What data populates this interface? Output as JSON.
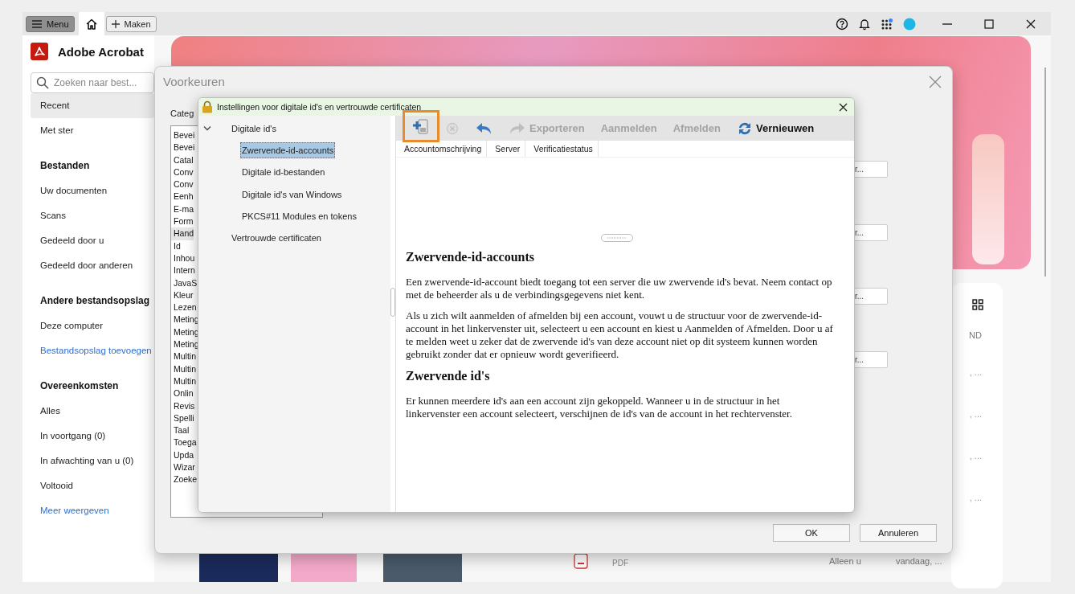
{
  "topbar": {
    "menu_label": "Menu",
    "new_label": "Maken"
  },
  "app": {
    "title": "Adobe Acrobat",
    "search_placeholder": "Zoeken naar best..."
  },
  "sidebar": {
    "sections": [
      {
        "items": [
          {
            "label": "Recent",
            "kind": "item",
            "selected": true
          },
          {
            "label": "Met ster",
            "kind": "item",
            "selected": false
          }
        ]
      },
      {
        "heading": "Bestanden",
        "items": [
          {
            "label": "Uw documenten",
            "kind": "item",
            "selected": false
          },
          {
            "label": "Scans",
            "kind": "item",
            "selected": false
          },
          {
            "label": "Gedeeld door u",
            "kind": "item",
            "selected": false
          },
          {
            "label": "Gedeeld door anderen",
            "kind": "item",
            "selected": false
          }
        ]
      },
      {
        "heading": "Andere bestandsopslag",
        "items": [
          {
            "label": "Deze computer",
            "kind": "item",
            "selected": false
          },
          {
            "label": "Bestandsopslag toevoegen",
            "kind": "link",
            "selected": false
          }
        ]
      },
      {
        "heading": "Overeenkomsten",
        "items": [
          {
            "label": "Alles",
            "kind": "item",
            "selected": false
          },
          {
            "label": "In voortgang (0)",
            "kind": "item",
            "selected": false
          },
          {
            "label": "In afwachting van u (0)",
            "kind": "item",
            "selected": false
          },
          {
            "label": "Voltooid",
            "kind": "item",
            "selected": false
          },
          {
            "label": "Meer weergeven",
            "kind": "link",
            "selected": false
          }
        ]
      }
    ]
  },
  "background": {
    "row_buttons": [
      "r...",
      "r...",
      "r...",
      "r..."
    ],
    "column_label": "ND",
    "row_dates": [
      ", ...",
      ", ...",
      ", ...",
      ", ..."
    ],
    "file_type": "PDF",
    "owner": "Alleen u",
    "date": "vandaag, ..."
  },
  "preferences": {
    "title": "Voorkeuren",
    "categories_label": "Categ",
    "categories": [
      {
        "label": "Bevei",
        "selected": false
      },
      {
        "label": "Bevei",
        "selected": false
      },
      {
        "label": "Catal",
        "selected": false
      },
      {
        "label": "Conv",
        "selected": false
      },
      {
        "label": "Conv",
        "selected": false
      },
      {
        "label": "Eenh",
        "selected": false
      },
      {
        "label": "E-ma",
        "selected": false
      },
      {
        "label": "Form",
        "selected": false
      },
      {
        "label": "Hand",
        "selected": true
      },
      {
        "label": "Id",
        "selected": false
      },
      {
        "label": "Inhou",
        "selected": false
      },
      {
        "label": "Intern",
        "selected": false
      },
      {
        "label": "JavaS",
        "selected": false
      },
      {
        "label": "Kleur",
        "selected": false
      },
      {
        "label": "Lezen",
        "selected": false
      },
      {
        "label": "Meting",
        "selected": false
      },
      {
        "label": "Meting",
        "selected": false
      },
      {
        "label": "Meting",
        "selected": false
      },
      {
        "label": "Multin",
        "selected": false
      },
      {
        "label": "Multin",
        "selected": false
      },
      {
        "label": "Multin",
        "selected": false
      },
      {
        "label": "Onlin",
        "selected": false
      },
      {
        "label": "Revis",
        "selected": false
      },
      {
        "label": "Spelli",
        "selected": false
      },
      {
        "label": "Taal",
        "selected": false
      },
      {
        "label": "Toega",
        "selected": false
      },
      {
        "label": "Upda",
        "selected": false
      },
      {
        "label": "Wizar",
        "selected": false
      },
      {
        "label": "Zoeke",
        "selected": false
      }
    ],
    "buttons": [
      "OK",
      "Annuleren"
    ]
  },
  "id_dialog": {
    "title": "Instellingen voor digitale id's en vertrouwde certificaten",
    "tree": [
      {
        "label": "Digitale id's",
        "selected": false,
        "expanded": true,
        "children": [
          {
            "label": "Zwervende-id-accounts",
            "selected": true
          },
          {
            "label": "Digitale id-bestanden",
            "selected": false
          },
          {
            "label": "Digitale id's van Windows",
            "selected": false
          },
          {
            "label": "PKCS#11 Modules en tokens",
            "selected": false
          }
        ]
      },
      {
        "label": "Vertrouwde certificaten",
        "selected": false
      }
    ],
    "toolbar": [
      {
        "kind": "add",
        "disabled": false,
        "highlighted": true
      },
      {
        "kind": "remove",
        "disabled": true,
        "highlighted": false
      },
      {
        "kind": "back",
        "disabled": false,
        "highlighted": false
      },
      {
        "kind": "export",
        "label": "Exporteren",
        "disabled": true,
        "highlighted": false
      },
      {
        "kind": "text",
        "label": "Aanmelden",
        "disabled": true,
        "highlighted": false
      },
      {
        "kind": "text",
        "label": "Afmelden",
        "disabled": true,
        "highlighted": false
      },
      {
        "kind": "refresh",
        "label": "Vernieuwen",
        "disabled": false,
        "highlighted": false
      }
    ],
    "columns": [
      "Accountomschrijving",
      "Server",
      "Verificatiestatus"
    ],
    "help": [
      {
        "kind": "heading",
        "text": "Zwervende-id-accounts"
      },
      {
        "kind": "paragraph",
        "text": "Een zwervende-id-account biedt toegang tot een server die uw zwervende id's bevat. Neem contact op met de beheerder als u de verbindingsgegevens niet kent."
      },
      {
        "kind": "paragraph",
        "text": "Als u zich wilt aanmelden of afmelden bij een account, vouwt u de structuur voor de zwervende-id-account in het linkervenster uit, selecteert u een account en kiest u Aanmelden of Afmelden. Door u af te melden weet u zeker dat de zwervende id's van deze account niet op dit systeem kunnen worden gebruikt zonder dat er opnieuw wordt geverifieerd."
      },
      {
        "kind": "heading",
        "text": "Zwervende id's"
      },
      {
        "kind": "paragraph",
        "text": "Er kunnen meerdere id's aan een account zijn gekoppeld. Wanneer u in de structuur in het linkervenster een account selecteert, verschijnen de id's van de account in het rechtervenster."
      }
    ]
  }
}
